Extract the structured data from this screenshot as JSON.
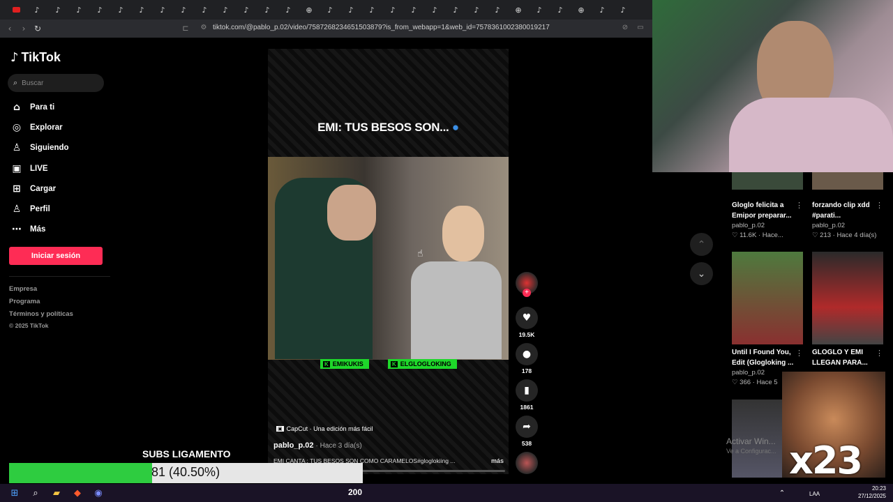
{
  "browser": {
    "url": "tiktok.com/@pablo_p.02/video/7587268234651503879?is_from_webapp=1&web_id=7578361002380019217"
  },
  "sidebar": {
    "brand": "TikTok",
    "search_placeholder": "Buscar",
    "items": [
      {
        "label": "Para ti",
        "icon": "home-icon"
      },
      {
        "label": "Explorar",
        "icon": "compass-icon"
      },
      {
        "label": "Siguiendo",
        "icon": "following-icon"
      },
      {
        "label": "LIVE",
        "icon": "live-icon"
      },
      {
        "label": "Cargar",
        "icon": "upload-icon"
      },
      {
        "label": "Perfil",
        "icon": "profile-icon"
      },
      {
        "label": "Más",
        "icon": "more-icon"
      }
    ],
    "login_label": "Iniciar sesión",
    "footer": [
      "Empresa",
      "Programa",
      "Términos y políticas",
      "© 2025 TikTok"
    ]
  },
  "video": {
    "title": "EMI: TUS BESOS SON...",
    "tags": [
      "EMIKUKIS",
      "ELGLOGLOKING"
    ],
    "capcut": "CapCut · Una edición más fácil",
    "author": "pablo_p.02",
    "posted": "· Hace 3 día(s)",
    "description": "EMI CANTA : TUS BESOS SON COMO CARAMELOS#gloglokiing ...",
    "more": "más"
  },
  "actions": {
    "likes": "19.5K",
    "comments": "178",
    "saves": "1861",
    "shares": "538"
  },
  "grid": [
    {
      "title1": "Gloglo felicita a",
      "title2": "Emipor preparar...",
      "user": "pablo_p.02",
      "stats": "♡ 11.6K · Hace..."
    },
    {
      "title1": "forzando clip xdd",
      "title2": "#parati...",
      "user": "pablo_p.02",
      "stats": "♡ 213 · Hace 4 día(s)"
    },
    {
      "title1": "Until I Found You,",
      "title2": "Edit (Glogloking ...",
      "user": "pablo_p.02",
      "stats": "♡ 366 · Hace 5"
    },
    {
      "title1": "GLOGLO Y EMI",
      "title2": "LLEGAN PARA...",
      "user": "",
      "stats": ""
    }
  ],
  "overlays": {
    "subs_label": "SUBS LIGAMENTO",
    "subs_value": "81 (40.50%)",
    "subs_progress": 0.405,
    "multiplier": "x23",
    "activate1": "Activar Win...",
    "activate2": "Ve a Configurac..."
  },
  "taskbar": {
    "count": "200",
    "lang": "LAA",
    "time": "20:23",
    "date": "27/12/2025"
  }
}
